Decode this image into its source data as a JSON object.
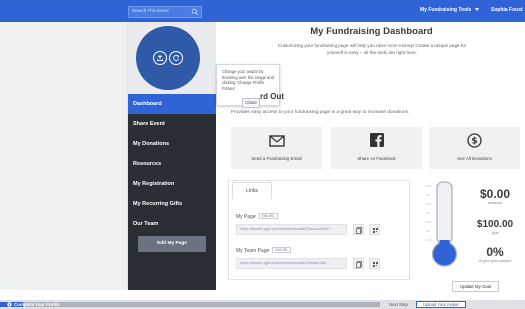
{
  "header": {
    "search_placeholder": "Search This Event",
    "fundraising_tools_label": "My Fundraising Tools",
    "user_name": "Sophia Foust",
    "brand_blue": "#2f63d6"
  },
  "sidebar": {
    "items": [
      {
        "label": "Dashboard"
      },
      {
        "label": "Share Event"
      },
      {
        "label": "My Donations"
      },
      {
        "label": "Resources"
      },
      {
        "label": "My Registration"
      },
      {
        "label": "My Recurring Gifts"
      },
      {
        "label": "Our Team"
      }
    ],
    "edit_page_label": "Edit My Page"
  },
  "tooltip": {
    "text": "Change your avatar by hovering over the image and clicking 'Change Profile Picture'",
    "close_label": "Close"
  },
  "main": {
    "title": "My Fundraising Dashboard",
    "subtitle": "Customizing your fundraising page will help you raise more money! Create a unique page for yourself is easy – all the tools are right here.",
    "section_heading": "rd Out",
    "section_sub": "Provides easy access to your fundraising page is a great way to increase donations.",
    "actions": [
      {
        "label": "Send a Fundraising Email",
        "icon": "envelope-icon"
      },
      {
        "label": "Share on Facebook",
        "icon": "facebook-icon"
      },
      {
        "label": "See All Donations",
        "icon": "dollar-circle-icon"
      }
    ]
  },
  "links": {
    "tab_label": "Links",
    "my_page_label": "My Page",
    "my_page_chip": "Edit URL",
    "my_page_url": "https://secure.qgiv.com/event/webwalk22/account/117...",
    "team_page_label": "My Team Page",
    "team_page_chip": "Edit URL",
    "team_page_url": "https://secure.qgiv.com/event/webwalk22/team/385..."
  },
  "goal": {
    "achieved_amount": "$0.00",
    "achieved_label": "achieved",
    "goal_amount": "$100.00",
    "goal_label": "goal",
    "percent": "0%",
    "percent_label": "of your goal reached",
    "percent_value": 0,
    "update_label": "Update My Goal"
  },
  "footer": {
    "progress_label": "Complete Your Profile",
    "progress_value": 0.06,
    "next_step_text": "Next Step",
    "next_step_button": "Upload Your Avatar"
  }
}
